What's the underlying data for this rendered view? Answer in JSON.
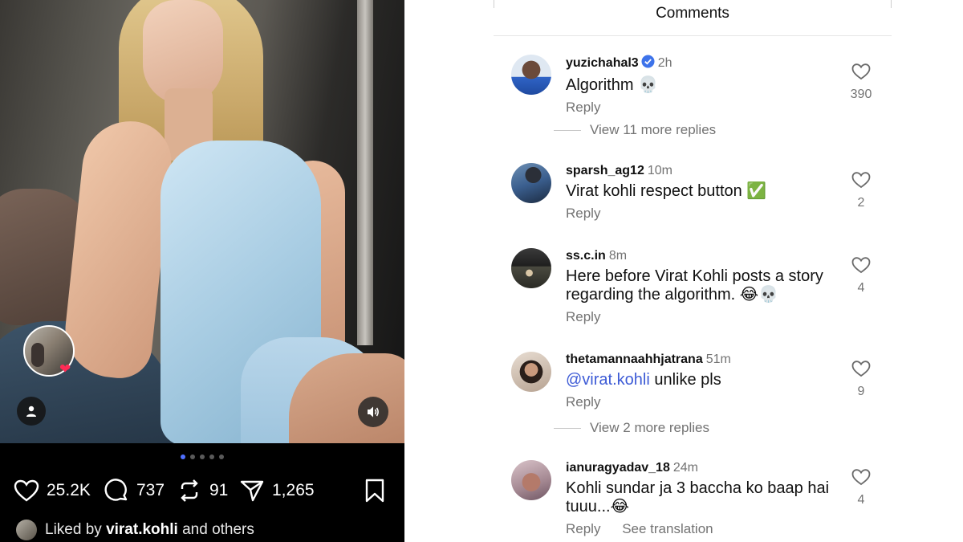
{
  "post": {
    "dots_total": 5,
    "dots_active_index": 0,
    "likes": "25.2K",
    "comments": "737",
    "reposts": "91",
    "shares": "1,265",
    "liked_by_prefix": "Liked by",
    "liked_by_user": "virat.kohli",
    "liked_by_suffix": "and others",
    "icons": {
      "like": "heart-icon",
      "comment": "comment-bubble-icon",
      "repost": "repost-icon",
      "share": "send-icon",
      "save": "bookmark-icon",
      "audio": "speaker-icon",
      "tags": "user-icon"
    },
    "accent": "#4f6fff"
  },
  "comments_panel": {
    "title": "Comments",
    "mention_color": "#3d5bd6",
    "reply_label": "Reply",
    "items": [
      {
        "username": "yuzichahal3",
        "verified": true,
        "time": "2h",
        "text": "Algorithm 💀",
        "likes": "390",
        "more_replies": "View 11 more replies"
      },
      {
        "username": "sparsh_ag12",
        "time": "10m",
        "text": "Virat kohli respect button ✅",
        "likes": "2"
      },
      {
        "username": "ss.c.in",
        "time": "8m",
        "text_line1": "Here before Virat Kohli posts a story",
        "text_line2": "regarding the algorithm. 😂💀",
        "likes": "4"
      },
      {
        "username": "thetamannaahhjatrana",
        "time": "51m",
        "mention": "@virat.kohli",
        "text": "unlike pls",
        "likes": "9",
        "more_replies": "View 2 more replies"
      },
      {
        "username": "ianuragyadav_18",
        "time": "24m",
        "text_line1": "Kohli sundar ja 3 baccha ko baap hai",
        "text_line2": "tuuu...😂",
        "likes": "4",
        "see_translation": "See translation"
      }
    ]
  }
}
